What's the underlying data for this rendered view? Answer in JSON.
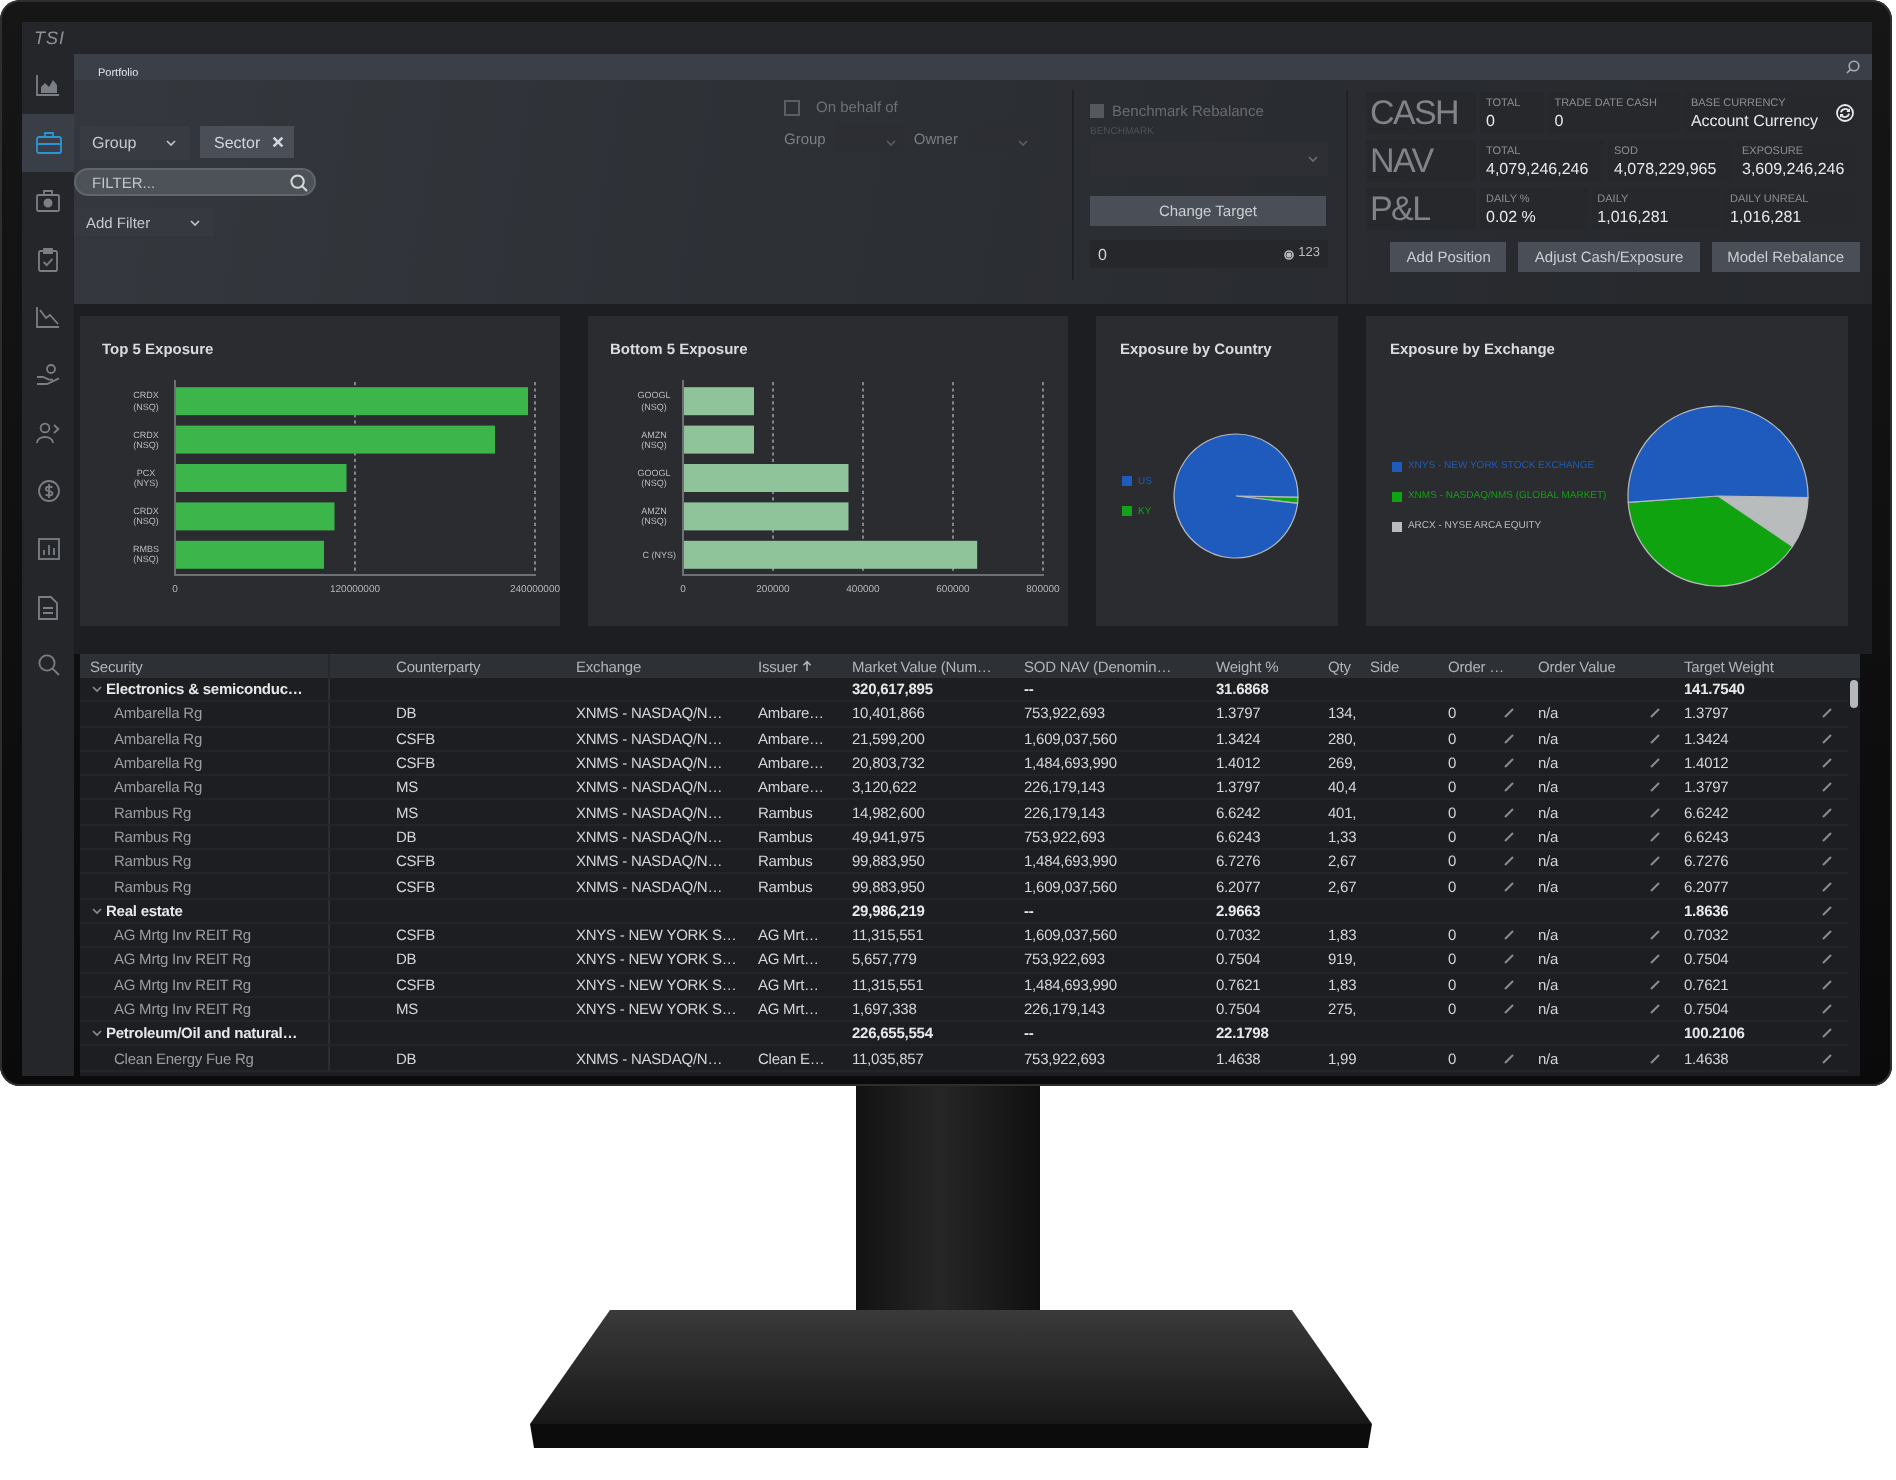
{
  "logo": {
    "text": "TSI"
  },
  "sidebar": {
    "items": [
      {
        "selected": false
      },
      {
        "selected": true
      },
      {
        "selected": false
      },
      {
        "selected": false
      },
      {
        "selected": false
      },
      {
        "selected": false
      },
      {
        "selected": false
      },
      {
        "selected": false
      },
      {
        "selected": false
      },
      {
        "selected": false
      },
      {
        "selected": false
      }
    ]
  },
  "tabs": [
    {
      "label": "Portfolio",
      "selected": true
    }
  ],
  "filters": {
    "grouping": {
      "value": "Group"
    },
    "chips": [
      {
        "label": "Sector"
      }
    ],
    "search": {
      "placeholder": "FILTER..."
    },
    "add_filter": {
      "label": "Add Filter"
    }
  },
  "on_behalf": {
    "label": "On behalf of",
    "checked": false,
    "selects": [
      {
        "label": "Group"
      },
      {
        "label": "Owner"
      }
    ]
  },
  "benchmark": {
    "label": "Benchmark Rebalance",
    "checked": false,
    "disabled": true,
    "field_label": "BENCHMARK",
    "button": "Change Target",
    "target": {
      "value": "0",
      "count": "123"
    }
  },
  "stats": [
    {
      "title": "CASH",
      "cells": [
        {
          "kind": "value",
          "label": "TOTAL",
          "value": "0"
        },
        {
          "kind": "value",
          "label": "TRADE DATE CASH",
          "value": "0"
        },
        {
          "kind": "toggle",
          "label": "BASE CURRENCY",
          "value": "Account Currency"
        }
      ]
    },
    {
      "title": "NAV",
      "cells": [
        {
          "kind": "value",
          "label": "TOTAL",
          "value": "4,079,246,246"
        },
        {
          "kind": "value",
          "label": "SOD",
          "value": "4,078,229,965"
        },
        {
          "kind": "value",
          "label": "EXPOSURE",
          "value": "3,609,246,246"
        }
      ]
    },
    {
      "title": "P&L",
      "cells": [
        {
          "kind": "value",
          "label": "DAILY %",
          "value": "0.02 %"
        },
        {
          "kind": "value",
          "label": "DAILY",
          "value": "1,016,281"
        },
        {
          "kind": "value",
          "label": "DAILY UNREAL",
          "value": "1,016,281"
        }
      ]
    }
  ],
  "actions": [
    {
      "label": "Add Position"
    },
    {
      "label": "Adjust Cash/Exposure"
    },
    {
      "label": "Model Rebalance"
    }
  ],
  "charts": [
    {
      "kind": "bar",
      "chart_data": {
        "type": "bar",
        "orientation": "horizontal",
        "grid": true,
        "title": "Top 5 Exposure",
        "categories": [
          "CRDX (NSQ)",
          "CRDX (NSQ)",
          "PCX (NYS)",
          "CRDX (NSQ)",
          "RMBS (NSQ)"
        ],
        "series": [
          {
            "color": "#3cb54a",
            "values": [
              236000000,
              214000000,
              115000000,
              107000000,
              100000000
            ]
          }
        ],
        "xlim": [
          0,
          240000000
        ],
        "xticks": [
          0,
          120000000,
          240000000
        ]
      }
    },
    {
      "kind": "bar",
      "chart_data": {
        "type": "bar",
        "orientation": "horizontal",
        "grid": true,
        "title": "Bottom 5 Exposure",
        "categories": [
          "GOOGL (NSQ)",
          "AMZN (NSQ)",
          "GOOGL (NSQ)",
          "AMZN (NSQ)",
          "C (NYS)"
        ],
        "series": [
          {
            "color": "#8fc49b",
            "values": [
              160000,
              160000,
              370000,
              370000,
              656000
            ]
          }
        ],
        "xlim": [
          0,
          800000
        ],
        "xticks": [
          0,
          200000,
          400000,
          600000,
          800000
        ]
      }
    },
    {
      "kind": "pie",
      "title": "Exposure by Country",
      "legend": [
        {
          "label": "US",
          "color": "#1f5bbd"
        },
        {
          "label": "KY",
          "color": "#12a31a"
        }
      ]
    },
    {
      "kind": "pie",
      "title": "Exposure by Exchange",
      "legend": [
        {
          "label": "XNYS - NEW YORK STOCK EXCHANGE",
          "color": "#1f5bbd"
        },
        {
          "label": "XNMS - NASDAQ/NMS (GLOBAL MARKET)",
          "color": "#0fa30f"
        },
        {
          "label": "ARCX - NYSE ARCA EQUITY",
          "color": "#b9bcbd"
        }
      ]
    }
  ],
  "table": {
    "columns": [
      {
        "label": "Security",
        "sorted": false
      },
      {
        "label": "Counterparty",
        "sorted": false
      },
      {
        "label": "Exchange",
        "sorted": false
      },
      {
        "label": "Issuer",
        "sorted": true
      },
      {
        "label": "Market Value (Num…",
        "sorted": false
      },
      {
        "label": "SOD NAV (Denomin…",
        "sorted": false
      },
      {
        "label": "Weight %",
        "sorted": false
      },
      {
        "label": "Qty",
        "sorted": false
      },
      {
        "label": "Side",
        "sorted": false
      },
      {
        "label": "Order …",
        "sorted": false
      },
      {
        "label": "Order Value",
        "sorted": false
      },
      {
        "label": "Target Weight",
        "sorted": false
      }
    ],
    "rows": [
      {
        "security": "Electronics & semiconduc…",
        "market_value": "320,617,895",
        "sod_nav": "--",
        "weight": "31.6868",
        "target_weight": "141.7540",
        "editable": false,
        "expanded": true,
        "children": [
          {
            "security": "Ambarella Rg",
            "counterparty": "DB",
            "exchange": "XNMS - NASDAQ/N…",
            "issuer": "Ambare…",
            "market_value": "10,401,866",
            "sod_nav": "753,922,693",
            "weight": "1.3797",
            "qty": "134,",
            "order_qty": "0",
            "order_value": "n/a",
            "target_weight": "1.3797",
            "editable": true
          },
          {
            "security": "Ambarella Rg",
            "counterparty": "CSFB",
            "exchange": "XNMS - NASDAQ/N…",
            "issuer": "Ambare…",
            "market_value": "21,599,200",
            "sod_nav": "1,609,037,560",
            "weight": "1.3424",
            "qty": "280,",
            "order_qty": "0",
            "order_value": "n/a",
            "target_weight": "1.3424",
            "editable": true
          },
          {
            "security": "Ambarella Rg",
            "counterparty": "CSFB",
            "exchange": "XNMS - NASDAQ/N…",
            "issuer": "Ambare…",
            "market_value": "20,803,732",
            "sod_nav": "1,484,693,990",
            "weight": "1.4012",
            "qty": "269,",
            "order_qty": "0",
            "order_value": "n/a",
            "target_weight": "1.4012",
            "editable": true
          },
          {
            "security": "Ambarella Rg",
            "counterparty": "MS",
            "exchange": "XNMS - NASDAQ/N…",
            "issuer": "Ambare…",
            "market_value": "3,120,622",
            "sod_nav": "226,179,143",
            "weight": "1.3797",
            "qty": "40,4",
            "order_qty": "0",
            "order_value": "n/a",
            "target_weight": "1.3797",
            "editable": true
          },
          {
            "security": "Rambus Rg",
            "counterparty": "MS",
            "exchange": "XNMS - NASDAQ/N…",
            "issuer": "Rambus",
            "market_value": "14,982,600",
            "sod_nav": "226,179,143",
            "weight": "6.6242",
            "qty": "401,",
            "order_qty": "0",
            "order_value": "n/a",
            "target_weight": "6.6242",
            "editable": true
          },
          {
            "security": "Rambus Rg",
            "counterparty": "DB",
            "exchange": "XNMS - NASDAQ/N…",
            "issuer": "Rambus",
            "market_value": "49,941,975",
            "sod_nav": "753,922,693",
            "weight": "6.6243",
            "qty": "1,33",
            "order_qty": "0",
            "order_value": "n/a",
            "target_weight": "6.6243",
            "editable": true
          },
          {
            "security": "Rambus Rg",
            "counterparty": "CSFB",
            "exchange": "XNMS - NASDAQ/N…",
            "issuer": "Rambus",
            "market_value": "99,883,950",
            "sod_nav": "1,484,693,990",
            "weight": "6.7276",
            "qty": "2,67",
            "order_qty": "0",
            "order_value": "n/a",
            "target_weight": "6.7276",
            "editable": true
          },
          {
            "security": "Rambus Rg",
            "counterparty": "CSFB",
            "exchange": "XNMS - NASDAQ/N…",
            "issuer": "Rambus",
            "market_value": "99,883,950",
            "sod_nav": "1,609,037,560",
            "weight": "6.2077",
            "qty": "2,67",
            "order_qty": "0",
            "order_value": "n/a",
            "target_weight": "6.2077",
            "editable": true
          }
        ]
      },
      {
        "security": "Real estate",
        "market_value": "29,986,219",
        "sod_nav": "--",
        "weight": "2.9663",
        "target_weight": "1.8636",
        "editable": true,
        "expanded": true,
        "children": [
          {
            "security": "AG Mrtg Inv REIT Rg",
            "counterparty": "CSFB",
            "exchange": "XNYS - NEW YORK S…",
            "issuer": "AG Mrt…",
            "market_value": "11,315,551",
            "sod_nav": "1,609,037,560",
            "weight": "0.7032",
            "qty": "1,83",
            "order_qty": "0",
            "order_value": "n/a",
            "target_weight": "0.7032",
            "editable": true
          },
          {
            "security": "AG Mrtg Inv REIT Rg",
            "counterparty": "DB",
            "exchange": "XNYS - NEW YORK S…",
            "issuer": "AG Mrt…",
            "market_value": "5,657,779",
            "sod_nav": "753,922,693",
            "weight": "0.7504",
            "qty": "919,",
            "order_qty": "0",
            "order_value": "n/a",
            "target_weight": "0.7504",
            "editable": true
          },
          {
            "security": "AG Mrtg Inv REIT Rg",
            "counterparty": "CSFB",
            "exchange": "XNYS - NEW YORK S…",
            "issuer": "AG Mrt…",
            "market_value": "11,315,551",
            "sod_nav": "1,484,693,990",
            "weight": "0.7621",
            "qty": "1,83",
            "order_qty": "0",
            "order_value": "n/a",
            "target_weight": "0.7621",
            "editable": true
          },
          {
            "security": "AG Mrtg Inv REIT Rg",
            "counterparty": "MS",
            "exchange": "XNYS - NEW YORK S…",
            "issuer": "AG Mrt…",
            "market_value": "1,697,338",
            "sod_nav": "226,179,143",
            "weight": "0.7504",
            "qty": "275,",
            "order_qty": "0",
            "order_value": "n/a",
            "target_weight": "0.7504",
            "editable": true
          }
        ]
      },
      {
        "security": "Petroleum/Oil and natural…",
        "market_value": "226,655,554",
        "sod_nav": "--",
        "weight": "22.1798",
        "target_weight": "100.2106",
        "editable": true,
        "expanded": true,
        "children": [
          {
            "security": "Clean Energy Fue Rg",
            "counterparty": "DB",
            "exchange": "XNMS - NASDAQ/N…",
            "issuer": "Clean E…",
            "market_value": "11,035,857",
            "sod_nav": "753,922,693",
            "weight": "1.4638",
            "qty": "1,99",
            "order_qty": "0",
            "order_value": "n/a",
            "target_weight": "1.4638",
            "editable": true
          }
        ]
      }
    ]
  }
}
